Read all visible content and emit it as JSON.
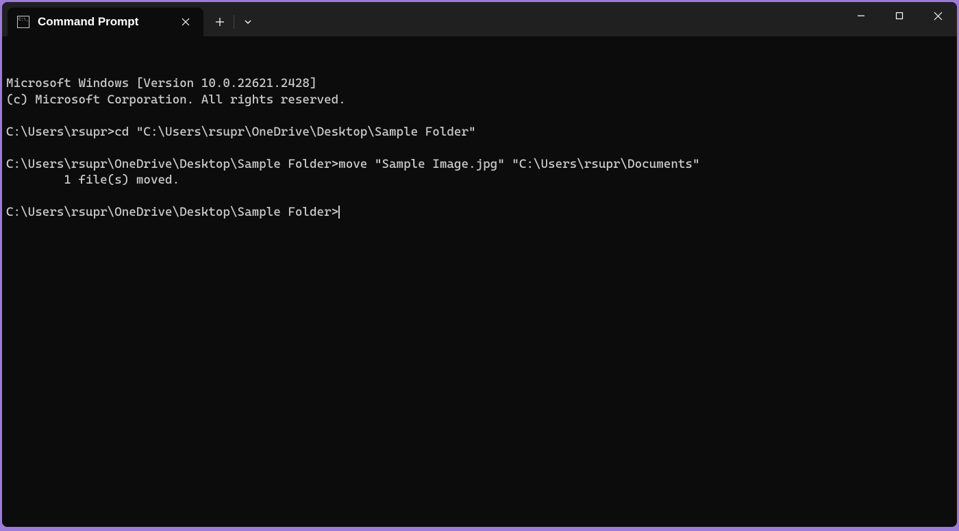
{
  "titlebar": {
    "tab": {
      "title": "Command Prompt"
    }
  },
  "terminal": {
    "lines": [
      "Microsoft Windows [Version 10.0.22621.2428]",
      "(c) Microsoft Corporation. All rights reserved.",
      "",
      "C:\\Users\\rsupr>cd \"C:\\Users\\rsupr\\OneDrive\\Desktop\\Sample Folder\"",
      "",
      "C:\\Users\\rsupr\\OneDrive\\Desktop\\Sample Folder>move \"Sample Image.jpg\" \"C:\\Users\\rsupr\\Documents\"",
      "        1 file(s) moved.",
      "",
      "C:\\Users\\rsupr\\OneDrive\\Desktop\\Sample Folder>"
    ]
  }
}
